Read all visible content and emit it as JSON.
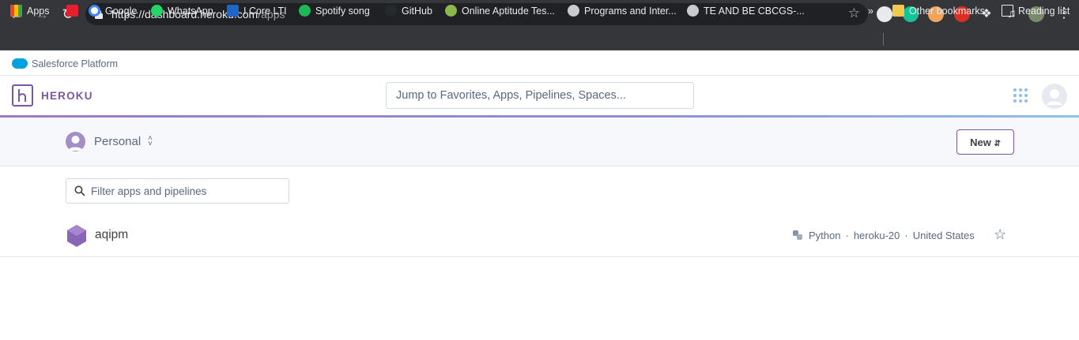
{
  "browser": {
    "url_host": "https://dashboard.heroku.com",
    "url_path": "/apps",
    "bookmarks": [
      "Apps",
      "Google",
      "WhatsApp",
      "I Core LTI",
      "Spotify song",
      "GitHub",
      "Online Aptitude Tes...",
      "Programs and Inter...",
      "TE AND BE CBCGS-..."
    ],
    "overflow_label": "»",
    "other_bookmarks": "Other bookmarks",
    "reading_list": "Reading list"
  },
  "salesforce": {
    "label": "Salesforce Platform"
  },
  "header": {
    "logo_text": "HEROKU",
    "search_placeholder": "Jump to Favorites, Apps, Pipelines, Spaces..."
  },
  "team": {
    "name": "Personal",
    "new_button": "New"
  },
  "filter": {
    "placeholder": "Filter apps and pipelines"
  },
  "apps": [
    {
      "name": "aqipm",
      "language": "Python",
      "stack": "heroku-20",
      "region": "United States"
    }
  ],
  "colors": {
    "brand": "#79589f",
    "text": "#3f3f44",
    "muted": "#596981",
    "chrome": "#35363a"
  }
}
